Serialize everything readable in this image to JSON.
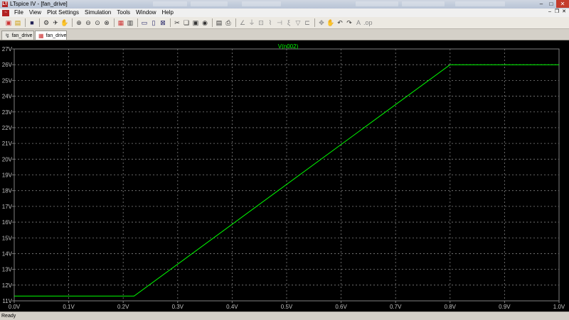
{
  "window": {
    "title": "LTspice IV - [fan_drive]",
    "minimize": "–",
    "maximize": "□",
    "close": "✕"
  },
  "menu": {
    "items": [
      "File",
      "View",
      "Plot Settings",
      "Simulation",
      "Tools",
      "Window",
      "Help"
    ]
  },
  "tabs": [
    {
      "label": "fan_drive",
      "kind": "schematic"
    },
    {
      "label": "fan_drive",
      "kind": "waveform",
      "active": true
    }
  ],
  "status": {
    "text": "Ready"
  },
  "colors": {
    "trace": "#00ff00",
    "plot_bg": "#000000",
    "axis_text": "#c0c0c0",
    "grid": "#808080"
  },
  "chart_data": {
    "type": "line",
    "title": "V(n002)",
    "xlabel": "",
    "ylabel": "",
    "xlim": [
      0.0,
      1.0
    ],
    "ylim": [
      11,
      27
    ],
    "x_ticks": [
      "0.0V",
      "0.1V",
      "0.2V",
      "0.3V",
      "0.4V",
      "0.5V",
      "0.6V",
      "0.7V",
      "0.8V",
      "0.9V",
      "1.0V"
    ],
    "y_ticks": [
      "11V",
      "12V",
      "13V",
      "14V",
      "15V",
      "16V",
      "17V",
      "18V",
      "19V",
      "20V",
      "21V",
      "22V",
      "23V",
      "24V",
      "25V",
      "26V",
      "27V"
    ],
    "grid": true,
    "series": [
      {
        "name": "V(n002)",
        "color": "#00ff00",
        "x": [
          0.0,
          0.22,
          0.8,
          1.0
        ],
        "y": [
          11.3,
          11.3,
          26.0,
          26.0
        ]
      }
    ]
  }
}
